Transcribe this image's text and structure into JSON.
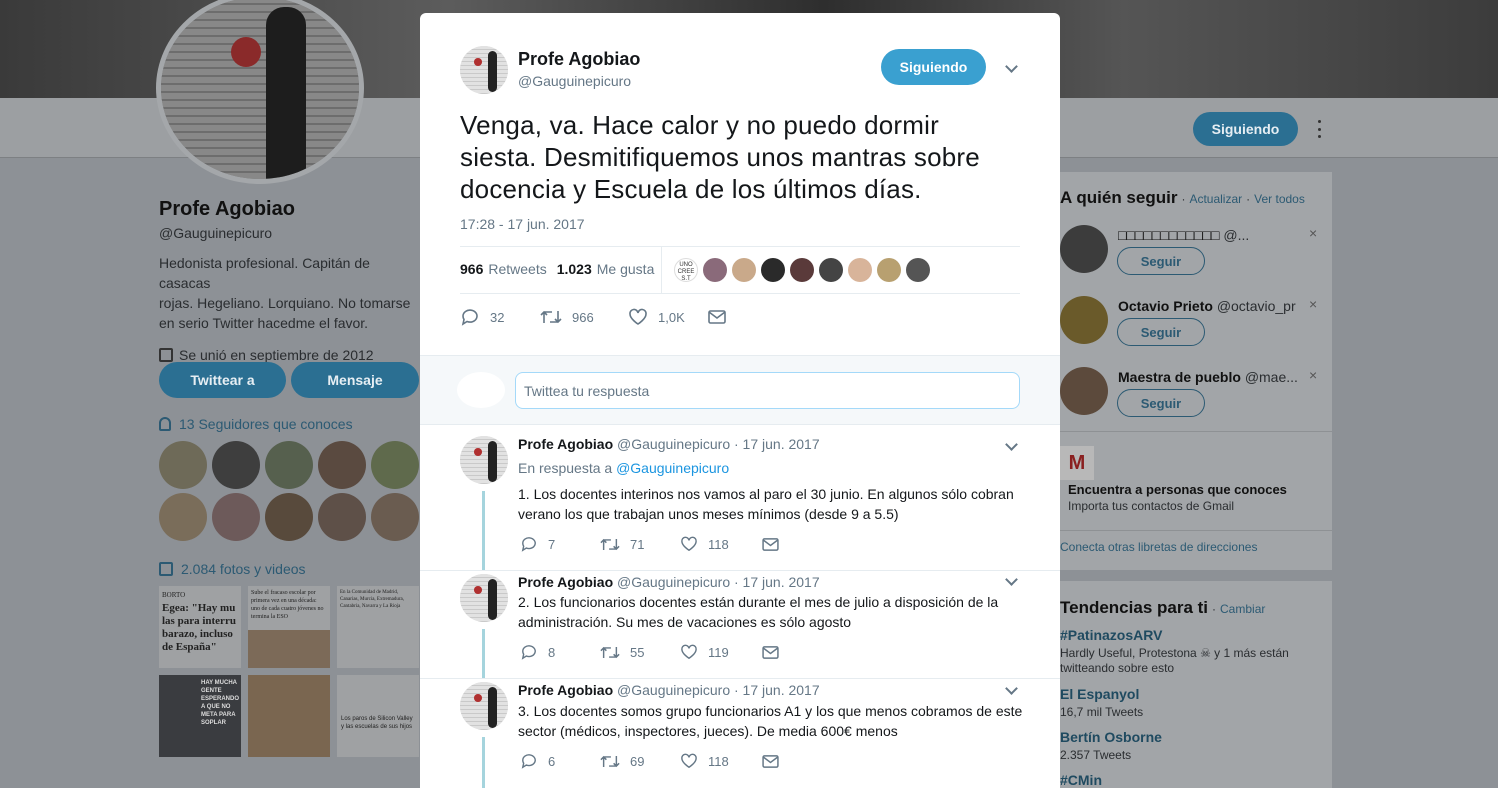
{
  "colors": {
    "accent": "#1b95e0",
    "follow_button": "#3aa0d0",
    "thread_line": "#a5d4dd"
  },
  "profile": {
    "name": "Profe Agobiao",
    "handle": "@Gauguinepicuro",
    "bio_lines": [
      "Hedonista profesional. Capitán de casacas",
      "rojas. Hegeliano. Lorquiano. No tomarse",
      "en serio Twitter hacedme el favor."
    ],
    "joined": "Se unió en septiembre de 2012",
    "tweet_to": "Twittear a",
    "message": "Mensaje",
    "followers_you_know": "13 Seguidores que conoces",
    "photos_videos": "2.084 fotos y videos",
    "following_button": "Siguiendo",
    "photo_texts": [
      "BORTO",
      "Egea: \"Hay mu las para interru barazo, incluso de España\"",
      "Sube el fracaso escolar por primera vez en una década: uno de cada cuatro jóvenes no termina la ESO",
      "En la Comunidad de Madrid, Canarias, Murcia, Extremadura, Cantabria, Navarra y La Rioja",
      "HAY MUCHA GENTE ESPERANDO A QUE NO META PARA SOPLAR",
      "Los paros de Silicon Valley y las escuelas de sus hijos"
    ]
  },
  "who_to_follow": {
    "title": "A quién seguir",
    "refresh": "Actualizar",
    "view_all": "Ver todos",
    "follow_label": "Seguir",
    "accounts": [
      {
        "name": "□□□□□□□□□□□□",
        "handle": "@..."
      },
      {
        "name": "Octavio Prieto",
        "handle": "@octavio_pr"
      },
      {
        "name": "Maestra de pueblo",
        "handle": "@mae..."
      }
    ],
    "gmail_title": "Encuentra a personas que conoces",
    "gmail_sub": "Importa tus contactos de Gmail",
    "other_books": "Conecta otras libretas de direcciones"
  },
  "trends": {
    "title": "Tendencias para ti",
    "change": "Cambiar",
    "items": [
      {
        "name": "#PatinazosARV",
        "meta": "Hardly Useful, Protestona ☠ y 1 más están",
        "meta2": "twitteando sobre esto"
      },
      {
        "name": "El Espanyol",
        "meta": "16,7 mil Tweets"
      },
      {
        "name": "Bertín Osborne",
        "meta": "2.357 Tweets"
      },
      {
        "name": "#CMin",
        "meta": ""
      }
    ]
  },
  "modal": {
    "author_name": "Profe Agobiao",
    "author_handle": "@Gauguinepicuro",
    "follow_label": "Siguiendo",
    "tweet_text": "Venga, va. Hace calor y no puedo dormir siesta. Desmitifiquemos unos mantras sobre docencia y Escuela de los últimos días.",
    "timestamp": "17:28 - 17 jun. 2017",
    "retweets_count": "966",
    "retweets_label": "Retweets",
    "likes_count": "1.023",
    "likes_label": "Me gusta",
    "liker_badge": "UNO CREE S.T",
    "actions": {
      "replies": "32",
      "retweets": "966",
      "likes": "1,0K"
    },
    "reply_placeholder": "Twittea tu respuesta",
    "replies": [
      {
        "name": "Profe Agobiao",
        "handle": "@Gauguinepicuro",
        "date": "· 17 jun. 2017",
        "in_reply_prefix": "En respuesta a",
        "in_reply_to": "@Gauguinepicuro",
        "text": "1. Los docentes interinos nos vamos al paro el 30 junio. En algunos sólo cobran verano los que trabajan unos meses mínimos (desde 9 a 5.5)",
        "replies": "7",
        "retweets": "71",
        "likes": "118"
      },
      {
        "name": "Profe Agobiao",
        "handle": "@Gauguinepicuro",
        "date": "· 17 jun. 2017",
        "text": "2. Los funcionarios docentes están durante el mes de julio a disposición de la administración. Su mes de vacaciones es sólo agosto",
        "replies": "8",
        "retweets": "55",
        "likes": "119"
      },
      {
        "name": "Profe Agobiao",
        "handle": "@Gauguinepicuro",
        "date": "· 17 jun. 2017",
        "text": "3. Los docentes somos grupo funcionarios A1 y los que menos cobramos de este sector (médicos, inspectores, jueces). De media 600€ menos",
        "replies": "6",
        "retweets": "69",
        "likes": "118"
      }
    ]
  }
}
